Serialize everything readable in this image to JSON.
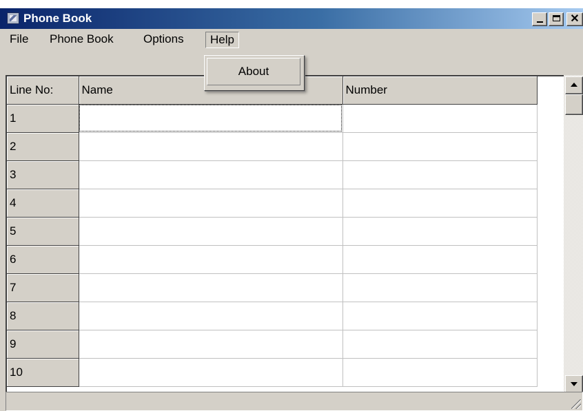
{
  "window": {
    "title": "Phone Book"
  },
  "menubar": {
    "items": [
      "File",
      "Phone Book",
      "Options",
      "Help"
    ],
    "open_menu": "Help"
  },
  "help_menu": {
    "items": [
      "About"
    ]
  },
  "grid": {
    "columns": [
      "Line No:",
      "Name",
      "Number"
    ],
    "rows": [
      {
        "line": "1",
        "name": "",
        "number": ""
      },
      {
        "line": "2",
        "name": "",
        "number": ""
      },
      {
        "line": "3",
        "name": "",
        "number": ""
      },
      {
        "line": "4",
        "name": "",
        "number": ""
      },
      {
        "line": "5",
        "name": "",
        "number": ""
      },
      {
        "line": "6",
        "name": "",
        "number": ""
      },
      {
        "line": "7",
        "name": "",
        "number": ""
      },
      {
        "line": "8",
        "name": "",
        "number": ""
      },
      {
        "line": "9",
        "name": "",
        "number": ""
      },
      {
        "line": "10",
        "name": "",
        "number": ""
      }
    ]
  },
  "statusbar": {
    "text": ""
  },
  "colors": {
    "titlebar_start": "#0a246a",
    "titlebar_end": "#a6caf0",
    "face": "#d4d0c8"
  },
  "icons": [
    "app-icon",
    "minimize-icon",
    "maximize-icon",
    "close-icon",
    "scroll-up-arrow-icon",
    "scroll-down-arrow-icon",
    "size-grip-icon"
  ]
}
